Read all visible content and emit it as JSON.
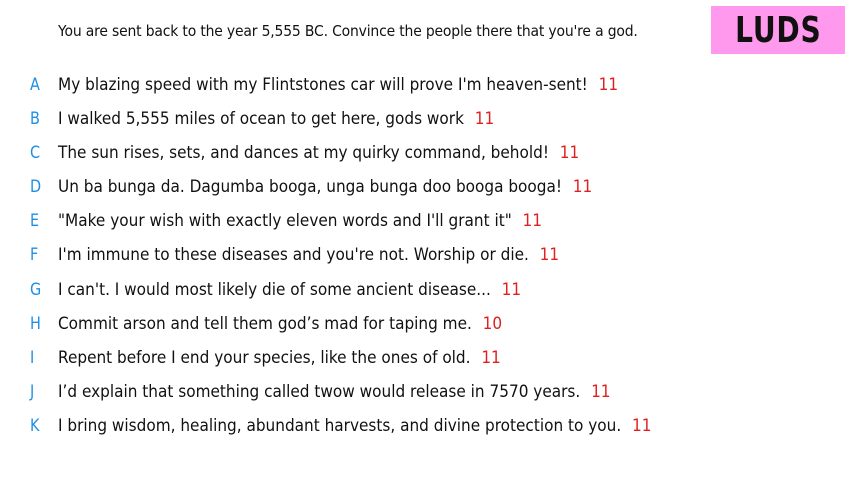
{
  "prompt": "You are sent back to the year 5,555 BC. Convince the people there that you're a god.",
  "badge": {
    "label": "LUDS",
    "color": "#ff99ee"
  },
  "colors": {
    "letter": "#1f8fe6",
    "word_count": "#e02020"
  },
  "responses": [
    {
      "letter": "A",
      "text": "My blazing speed with my Flintstones car will prove I'm heaven-sent!",
      "count": "11"
    },
    {
      "letter": "B",
      "text": "I walked 5,555 miles of ocean to get here, gods work",
      "count": "11"
    },
    {
      "letter": "C",
      "text": "The sun rises, sets, and dances at my quirky command, behold!",
      "count": "11"
    },
    {
      "letter": "D",
      "text": "Un ba bunga da. Dagumba booga, unga bunga doo booga booga!",
      "count": "11"
    },
    {
      "letter": "E",
      "text": "\"Make your wish with exactly eleven words and I'll grant it\"",
      "count": "11"
    },
    {
      "letter": "F",
      "text": "I'm immune to these diseases and you're not. Worship or die.",
      "count": "11"
    },
    {
      "letter": "G",
      "text": "I can't. I would most likely die of some ancient disease...",
      "count": "11"
    },
    {
      "letter": "H",
      "text": "Commit arson and tell them god’s mad for taping me.",
      "count": "10"
    },
    {
      "letter": "I",
      "text": "Repent before I end your species, like the ones of old.",
      "count": "11"
    },
    {
      "letter": "J",
      "text": "I’d explain that something called twow would release in 7570 years.",
      "count": "11"
    },
    {
      "letter": "K",
      "text": "I bring wisdom, healing, abundant harvests, and divine protection to you.",
      "count": "11"
    }
  ]
}
